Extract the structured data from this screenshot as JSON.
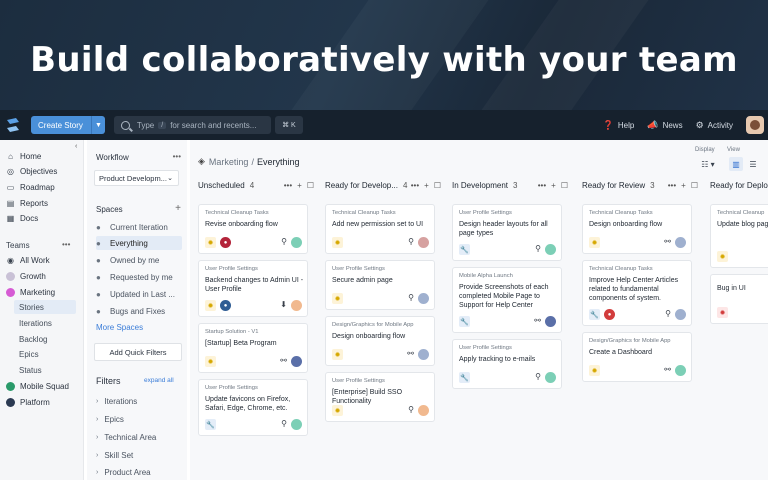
{
  "hero": {
    "headline": "Build collaboratively with your team"
  },
  "topbar": {
    "create_label": "Create Story",
    "search_type": "Type",
    "search_key": "/",
    "search_rest": "for search and recents...",
    "shortcut": "⌘ K",
    "help": "Help",
    "news": "News",
    "activity": "Activity"
  },
  "leftnav": {
    "home": "Home",
    "objectives": "Objectives",
    "roadmap": "Roadmap",
    "reports": "Reports",
    "docs": "Docs",
    "teams": "Teams",
    "all_work": "All Work",
    "growth": "Growth",
    "marketing": "Marketing",
    "stories": "Stories",
    "iterations": "Iterations",
    "backlog": "Backlog",
    "epics": "Epics",
    "status": "Status",
    "mobile_squad": "Mobile Squad",
    "platform": "Platform"
  },
  "side2": {
    "workflow": "Workflow",
    "workflow_value": "Product Developm...",
    "spaces": "Spaces",
    "items": [
      "Current Iteration",
      "Everything",
      "Owned by me",
      "Requested by me",
      "Updated in Last ...",
      "Bugs and Fixes"
    ],
    "more": "More Spaces",
    "quick_filters": "Add Quick Filters",
    "filters": "Filters",
    "expand_all": "expand all",
    "filter_items": [
      "Iterations",
      "Epics",
      "Technical Area",
      "Skill Set",
      "Product Area"
    ]
  },
  "board": {
    "crumb_team": "Marketing",
    "crumb_sep": "/",
    "crumb_space": "Everything",
    "display": "Display",
    "view": "View",
    "columns": [
      {
        "name": "Unscheduled",
        "count": "4"
      },
      {
        "name": "Ready for Develop...",
        "count": "4"
      },
      {
        "name": "In Development",
        "count": "3"
      },
      {
        "name": "Ready for Review",
        "count": "3"
      },
      {
        "name": "Ready for Deplo",
        "count": ""
      }
    ],
    "cards": [
      {
        "epic": "Technical Cleanup Tasks",
        "title": "Revise onboarding flow"
      },
      {
        "epic": "User Profile Settings",
        "title": "Backend changes to Admin UI - User Profile"
      },
      {
        "epic": "Startup Solution - V1",
        "title": "[Startup] Beta Program"
      },
      {
        "epic": "User Profile Settings",
        "title": "Update favicons on Firefox, Safari, Edge, Chrome, etc."
      },
      {
        "epic": "Technical Cleanup Tasks",
        "title": "Add new permission set to UI"
      },
      {
        "epic": "User Profile Settings",
        "title": "Secure admin page"
      },
      {
        "epic": "Design/Graphics for Mobile App",
        "title": "Design onboarding flow"
      },
      {
        "epic": "User Profile Settings",
        "title": "[Enterprise] Build SSO Functionality"
      },
      {
        "epic": "User Profile Settings",
        "title": "Design header layouts for all page types"
      },
      {
        "epic": "Mobile Alpha Launch",
        "title": "Provide Screenshots of each completed Mobile Page to Support for Help Center"
      },
      {
        "epic": "User Profile Settings",
        "title": "Apply tracking to e-mails"
      },
      {
        "epic": "Technical Cleanup Tasks",
        "title": "Design onboarding flow"
      },
      {
        "epic": "Technical Cleanup Tasks",
        "title": "Improve Help Center Articles related to fundamental components of system."
      },
      {
        "epic": "Design/Graphics for Mobile App",
        "title": "Create a Dashboard"
      },
      {
        "epic": "Technical Cleanup",
        "title": "Update blog pag banner image"
      },
      {
        "epic": "",
        "title": "Bug in UI"
      }
    ]
  },
  "colors": {
    "accent": "#4a90d9",
    "topbar": "#16212d",
    "feature": "#d6a800",
    "bug": "#d23c3c",
    "chore": "#2f5d94"
  }
}
